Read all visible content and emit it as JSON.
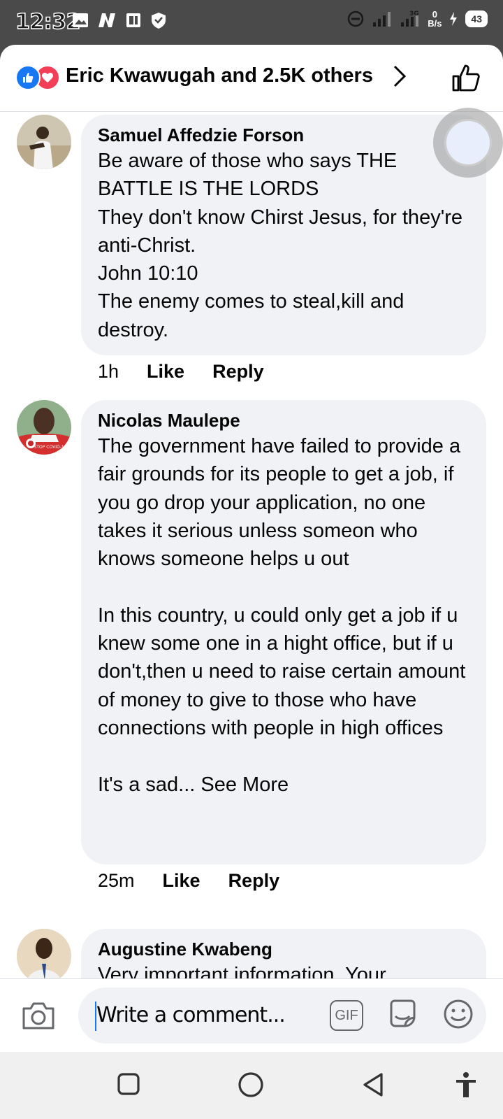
{
  "status_bar": {
    "time": "12:32",
    "net_speed_top": "0",
    "net_speed_unit": "B/s",
    "network_type": "3G",
    "battery": "43",
    "icons": [
      "image-icon",
      "n-app-icon",
      "news-icon",
      "shield-icon",
      "do-not-disturb-icon",
      "signal-icon",
      "signal-icon",
      "charging-icon",
      "battery-icon"
    ]
  },
  "reactions": {
    "summary": "Eric Kwawugah and 2.5K others",
    "icons": [
      "like-reaction-icon",
      "love-reaction-icon"
    ]
  },
  "comments": [
    {
      "author": "Samuel Affedzie Forson",
      "text": "Be aware of those who says THE BATTLE IS THE LORDS\nThey don't know Chirst Jesus, for they're anti-Christ.\nJohn 10:10\nThe enemy comes to steal,kill and destroy.",
      "time": "1h",
      "like_label": "Like",
      "reply_label": "Reply"
    },
    {
      "author": "Nicolas Maulepe",
      "text": "The government have failed to provide a fair grounds for its people to get a job, if you go drop your application, no one takes it serious unless someon who knows someone helps u out\n\nIn this country, u could only get a job if u knew some one in a hight office, but if u don't,then u need to raise certain amount of money to give to those who have connections with people in high offices\n\nIt's a sad...",
      "see_more": "See More",
      "avatar_caption": "STOP COVID-19",
      "time": "25m",
      "like_label": "Like",
      "reply_label": "Reply"
    },
    {
      "author": "Augustine Kwabeng",
      "text": "Very important information. Your"
    }
  ],
  "composer": {
    "placeholder": "Write a comment...",
    "gif_label": "GIF"
  }
}
